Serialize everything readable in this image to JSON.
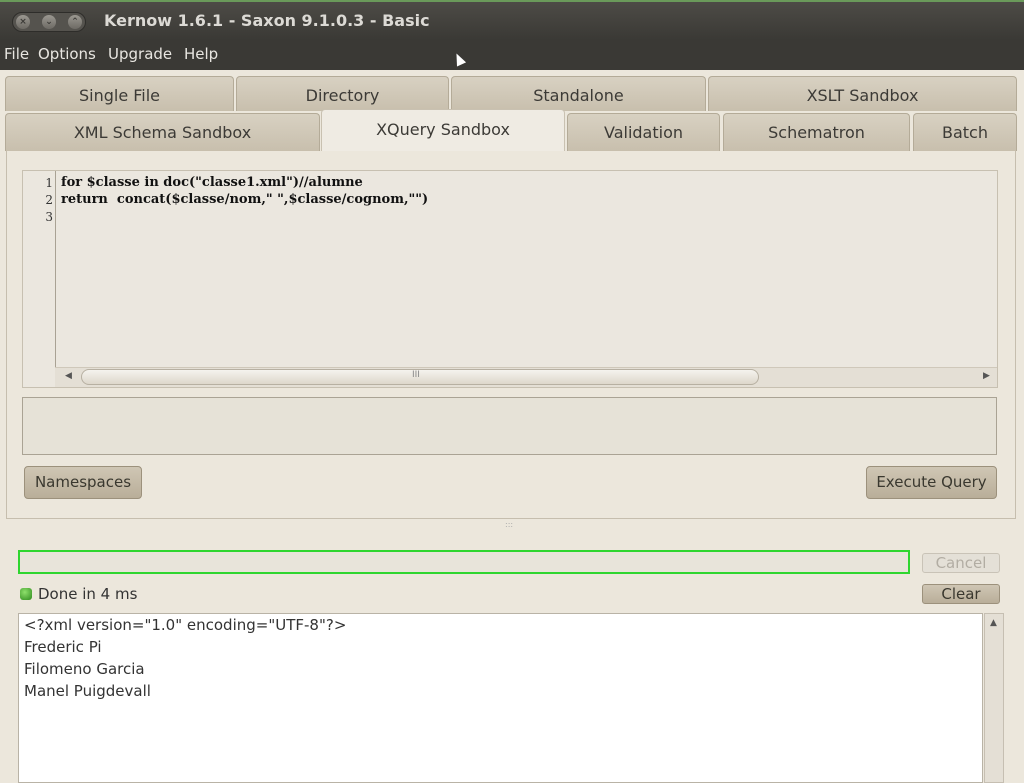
{
  "window": {
    "title": "Kernow 1.6.1 - Saxon 9.1.0.3 - Basic",
    "buttons": [
      "close",
      "minimize",
      "maximize"
    ]
  },
  "menu": [
    "File",
    "Options",
    "Upgrade",
    "Help"
  ],
  "tabs_row1": [
    "Single File",
    "Directory",
    "Standalone",
    "XSLT Sandbox"
  ],
  "tabs_row2": [
    "XML Schema Sandbox",
    "XQuery Sandbox",
    "Validation",
    "Schematron",
    "Batch"
  ],
  "active_tab": "XQuery Sandbox",
  "editor": {
    "line_numbers": [
      "1",
      "2",
      "3"
    ],
    "lines": [
      "for $classe in doc(\"classe1.xml\")//alumne",
      "return  concat($classe/nom,\" \",$classe/cognom,\"\")",
      ""
    ],
    "scroll_grip": "III"
  },
  "buttons": {
    "namespaces": "Namespaces",
    "execute_query": "Execute Query",
    "cancel": "Cancel",
    "clear": "Clear"
  },
  "status": {
    "text": "Done in 4 ms",
    "color": "#3aa12a"
  },
  "output": {
    "lines": [
      "<?xml version=\"1.0\" encoding=\"UTF-8\"?>",
      "Frederic Pi",
      "Filomeno Garcia",
      "Manel Puigdevall"
    ]
  },
  "colors": {
    "progress_border": "#2fd62f",
    "titlebar": "#3a3935"
  }
}
